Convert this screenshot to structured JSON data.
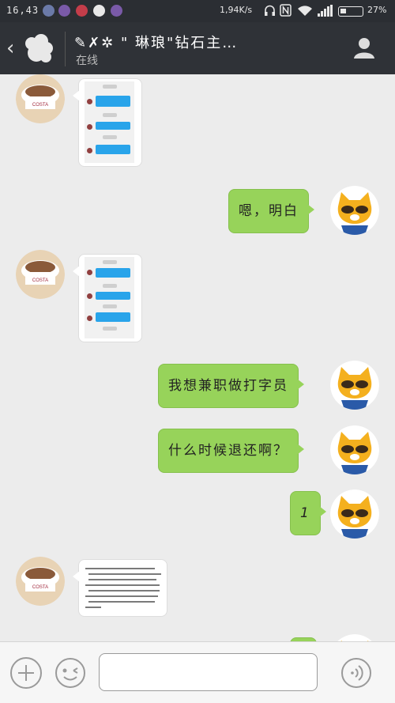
{
  "status_bar": {
    "time": "16,43",
    "net_speed": "1,94K/s",
    "battery": "27%"
  },
  "header": {
    "title": "✎✗✲ \" 琳琅\"钻石主…",
    "status": "在线"
  },
  "messages": [
    {
      "side": "left",
      "kind": "image",
      "content": "app-screenshot"
    },
    {
      "side": "right",
      "kind": "text",
      "text": "嗯，明白"
    },
    {
      "side": "left",
      "kind": "image",
      "content": "app-screenshot"
    },
    {
      "side": "right",
      "kind": "text",
      "text": "我想兼职做打字员"
    },
    {
      "side": "right",
      "kind": "text",
      "text": "什么时候退还啊？"
    },
    {
      "side": "right",
      "kind": "text",
      "text": "1"
    },
    {
      "side": "left",
      "kind": "image",
      "content": "text-document"
    }
  ],
  "colors": {
    "sent_bubble": "#97d35a",
    "header_bg": "#2f3237",
    "chat_bg": "#ececec",
    "accent_blue": "#29a4ea"
  },
  "icons": [
    "back-icon",
    "contact-avatar",
    "person-icon",
    "plus-icon",
    "emoji-icon",
    "voice-icon"
  ]
}
